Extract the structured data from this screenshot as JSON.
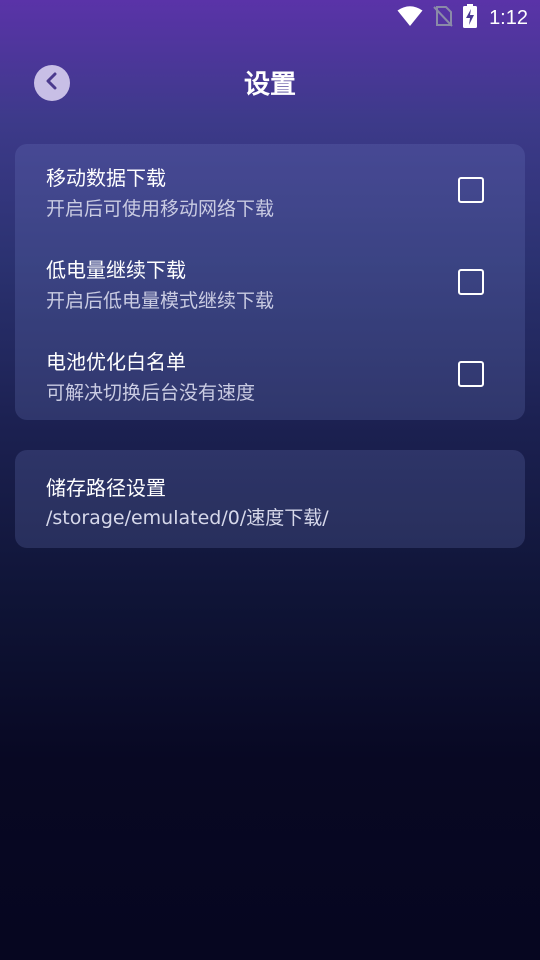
{
  "status_bar": {
    "time": "1:12",
    "icons": [
      "wifi-icon",
      "no-sim-icon",
      "battery-charging-icon"
    ]
  },
  "header": {
    "title": "设置",
    "back_icon": "chevron-left-icon"
  },
  "settings": {
    "items": [
      {
        "title": "移动数据下载",
        "description": "开启后可使用移动网络下载",
        "checked": false
      },
      {
        "title": "低电量继续下载",
        "description": "开启后低电量模式继续下载",
        "checked": false
      },
      {
        "title": "电池优化白名单",
        "description": "可解决切换后台没有速度",
        "checked": false
      }
    ]
  },
  "storage": {
    "title": "储存路径设置",
    "path": "/storage/emulated/0/速度下载/"
  },
  "colors": {
    "background_top": "#5a33a8",
    "background_bottom": "#060620",
    "card": "#3a4485",
    "back_button": "#c8bfe6",
    "text_primary": "#ffffff",
    "text_secondary": "#c9cbe2"
  }
}
